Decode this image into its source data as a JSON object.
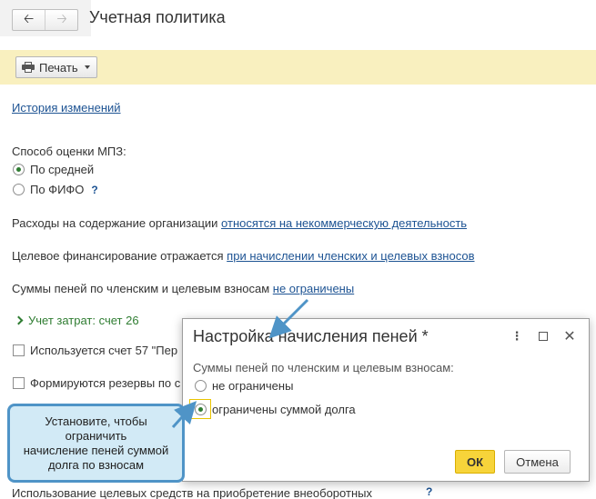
{
  "header": {
    "title": "Учетная политика",
    "nav_back_icon": "arrow-left-icon",
    "nav_forward_icon": "arrow-right-icon"
  },
  "toolbar": {
    "print_label": "Печать",
    "print_icon": "printer-icon"
  },
  "form": {
    "history_link": "История изменений",
    "mpz_label": "Способ оценки МПЗ:",
    "mpz_options": [
      "По средней",
      "По ФИФО"
    ],
    "mpz_selected": "По средней",
    "help_mark": "?",
    "expenses_label": "Расходы на содержание организации",
    "expenses_link": "относятся на некоммерческую деятельность",
    "financing_label": "Целевое финансирование отражается",
    "financing_link": "при начислении членских и целевых взносов",
    "penalties_label": "Суммы пеней по членским и целевым взносам",
    "penalties_link": "не ограничены",
    "cost_group_label": "Учет затрат: счет 26",
    "checkbox_57": "Используется счет 57 \"Пер",
    "checkbox_reserves": "Формируются резервы по с",
    "bottom_row": "Использование целевых средств на приобретение внеоборотных"
  },
  "dialog": {
    "title": "Настройка начисления пеней *",
    "label": "Суммы пеней по членским и целевым взносам:",
    "options": [
      "не ограничены",
      "ограничены суммой долга"
    ],
    "selected": "ограничены суммой долга",
    "ok_label": "ОК",
    "cancel_label": "Отмена"
  },
  "callout": {
    "text": "Установите, чтобы ограничить\nначисление пеней суммой\nдолга по взносам"
  },
  "colors": {
    "toolbar_bg": "#f9f0bf",
    "link": "#1d5393",
    "accent_green": "#2f7d32",
    "ok_button": "#f7d43a",
    "callout_bg": "#d2eaf6",
    "callout_border": "#4f94c7",
    "arrow": "#4f94c7"
  }
}
